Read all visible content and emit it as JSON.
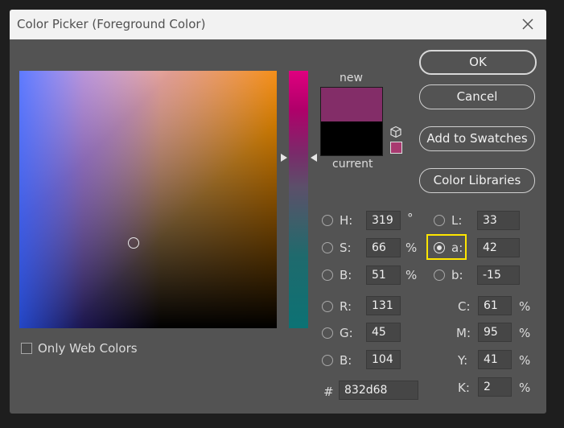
{
  "dialog": {
    "title": "Color Picker (Foreground Color)",
    "close_glyph": "×"
  },
  "swatches": {
    "new_label": "new",
    "current_label": "current",
    "new_color": "#832d68",
    "current_color": "#000000",
    "gamut_icon": "cube-icon"
  },
  "buttons": {
    "ok": "OK",
    "cancel": "Cancel",
    "add_to_swatches": "Add to Swatches",
    "color_libraries": "Color Libraries"
  },
  "fields": {
    "h": {
      "label": "H:",
      "value": "319",
      "unit": "°"
    },
    "s": {
      "label": "S:",
      "value": "66",
      "unit": "%"
    },
    "br": {
      "label": "B:",
      "value": "51",
      "unit": "%"
    },
    "r": {
      "label": "R:",
      "value": "131"
    },
    "g": {
      "label": "G:",
      "value": "45"
    },
    "b": {
      "label": "B:",
      "value": "104"
    },
    "L": {
      "label": "L:",
      "value": "33"
    },
    "a": {
      "label": "a:",
      "value": "42",
      "selected": true
    },
    "lab_b": {
      "label": "b:",
      "value": "-15"
    },
    "c": {
      "label": "C:",
      "value": "61",
      "unit": "%"
    },
    "m": {
      "label": "M:",
      "value": "95",
      "unit": "%"
    },
    "y": {
      "label": "Y:",
      "value": "41",
      "unit": "%"
    },
    "k": {
      "label": "K:",
      "value": "2",
      "unit": "%"
    },
    "hex": {
      "label": "#",
      "value": "832d68"
    }
  },
  "options": {
    "only_web_colors": "Only Web Colors"
  },
  "colors": {
    "highlight": "#ffe600",
    "dialog_bg": "#535353"
  }
}
